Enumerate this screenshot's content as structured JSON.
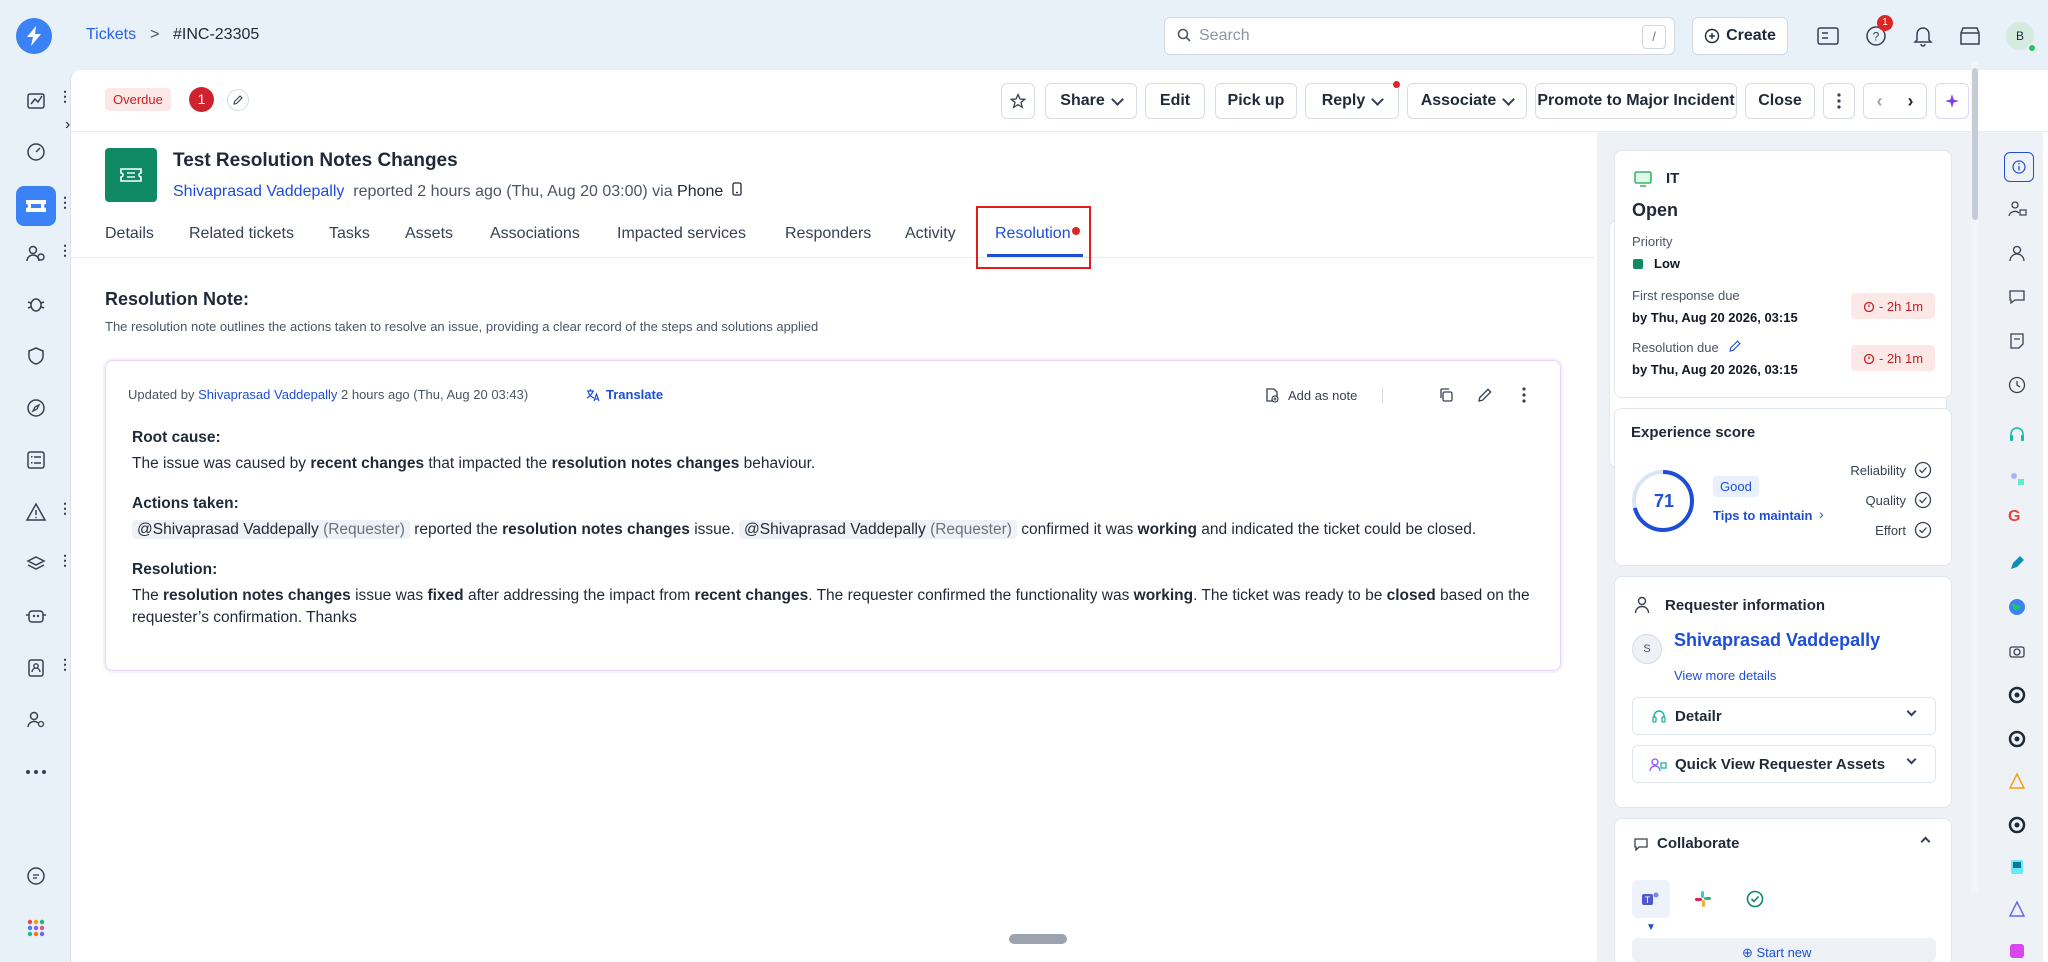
{
  "breadcrumb": {
    "parent": "Tickets",
    "separator": ">",
    "current": "#INC-23305"
  },
  "search": {
    "placeholder": "Search",
    "shortcut": "/"
  },
  "topbar": {
    "create_label": "Create",
    "help_badge": "1",
    "avatar_initial": "B"
  },
  "actions": {
    "overdue": "Overdue",
    "count": "1",
    "share": "Share",
    "edit": "Edit",
    "pickup": "Pick up",
    "reply": "Reply",
    "associate": "Associate",
    "promote": "Promote to Major Incident",
    "close": "Close"
  },
  "ticket": {
    "title": "Test Resolution Notes Changes",
    "requester": "Shivaprasad Vaddepally",
    "meta": "reported 2 hours ago (Thu, Aug 20 03:00) via",
    "channel": "Phone"
  },
  "tabs": [
    "Details",
    "Related tickets",
    "Tasks",
    "Assets",
    "Associations",
    "Impacted services",
    "Responders",
    "Activity",
    "Resolution"
  ],
  "resolution": {
    "heading": "Resolution Note:",
    "description": "The resolution note outlines the actions taken to resolve an issue, providing a clear record of the steps and solutions applied",
    "updated_by_prefix": "Updated by",
    "updated_by": "Shivaprasad Vaddepally",
    "updated_when": "2 hours ago (Thu, Aug 20 03:43)",
    "translate": "Translate",
    "add_as_note": "Add as note",
    "root_cause_heading": "Root cause:",
    "root_cause": {
      "p1": "The issue was caused by ",
      "b1": "recent changes",
      "p2": " that impacted the ",
      "b2": "resolution notes changes",
      "p3": " behaviour."
    },
    "actions_heading": "Actions taken:",
    "actions": {
      "m1_name": "@Shivaprasad Vaddepally",
      "m1_role": "(Requester)",
      "p1": " reported the ",
      "b1": "resolution notes changes",
      "p2": " issue. ",
      "m2_name": "@Shivaprasad Vaddepally",
      "m2_role": "(Requester)",
      "p3": " confirmed it was ",
      "b2": "working",
      "p4": " and indicated the ticket could be closed."
    },
    "resolution_heading": "Resolution:",
    "resolution_text": {
      "p1": "The ",
      "b1": "resolution notes changes",
      "p2": " issue was ",
      "b2": "fixed",
      "p3": " after addressing the impact from ",
      "b3": "recent changes",
      "p4": ". The requester confirmed the functionality was ",
      "b4": "working",
      "p5": ". The ticket was ready to be ",
      "b5": "closed",
      "p6": " based on the requester’s confirmation. Thanks"
    }
  },
  "sidebar": {
    "group": "IT",
    "status": "Open",
    "priority_label": "Priority",
    "priority_value": "Low",
    "first_response_label": "First response due",
    "first_response_value": "by Thu, Aug 20 2026, 03:15",
    "first_response_sla": "- 2h 1m",
    "resolution_due_label": "Resolution due",
    "resolution_due_value": "by Thu, Aug 20 2026, 03:15",
    "resolution_sla": "- 2h 1m",
    "experience_title": "Experience score",
    "score": "71",
    "score_badge": "Good",
    "tips": "Tips to maintain",
    "reliability": "Reliability",
    "quality": "Quality",
    "effort": "Effort",
    "requester_title": "Requester information",
    "requester_initial": "S",
    "requester_name": "Shivaprasad Vaddepally",
    "view_more": "View more details",
    "detailr": "Detailr",
    "quick_view": "Quick View Requester Assets",
    "collaborate": "Collaborate",
    "start_new": "Start new"
  },
  "colors": {
    "accent": "#1d4ed8",
    "overdue_bg": "#fde8e8",
    "danger": "#dc2626",
    "ticket_icon": "#0f8a63"
  }
}
